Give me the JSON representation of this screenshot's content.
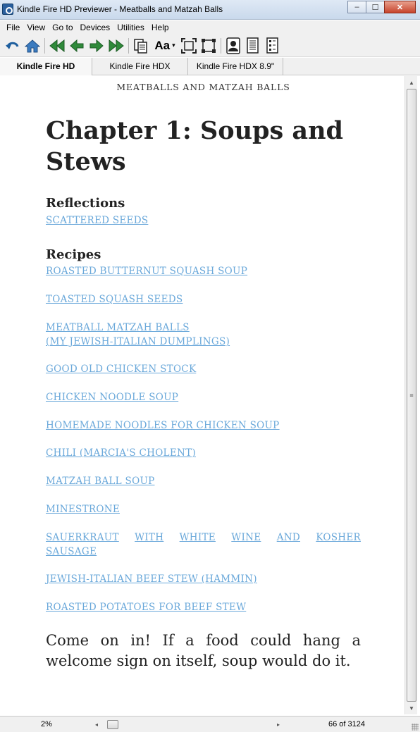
{
  "window": {
    "title": "Kindle Fire HD Previewer - Meatballs and Matzah Balls",
    "minimize_label": "‒",
    "maximize_label": "☐",
    "close_label": "✕"
  },
  "menu": {
    "items": [
      "File",
      "View",
      "Go to",
      "Devices",
      "Utilities",
      "Help"
    ]
  },
  "toolbar": {
    "font_label": "Aa",
    "font_caret": "▾",
    "icons": [
      "undo-icon",
      "home-icon",
      "first-page-icon",
      "previous-page-icon",
      "next-page-icon",
      "last-page-icon",
      "document-icon",
      "font-size-icon",
      "fit-page-icon",
      "full-screen-icon",
      "contact-card-icon",
      "book-page-icon",
      "book-info-icon"
    ]
  },
  "device_tabs": [
    {
      "label": "Kindle Fire HD",
      "active": true
    },
    {
      "label": "Kindle Fire HDX",
      "active": false
    },
    {
      "label": "Kindle Fire HDX 8.9\"",
      "active": false
    }
  ],
  "book": {
    "running_head": "MEATBALLS AND MATZAH BALLS",
    "chapter_title_line1": "Chapter 1: Soups and",
    "chapter_title_line2": "Stews",
    "reflections_heading": "Reflections",
    "reflections_links": [
      "SCATTERED SEEDS"
    ],
    "recipes_heading": "Recipes",
    "recipe_links": [
      "ROASTED BUTTERNUT SQUASH SOUP",
      "TOASTED SQUASH SEEDS",
      "MEATBALL MATZAH BALLS",
      "(MY JEWISH-ITALIAN DUMPLINGS)",
      "GOOD OLD CHICKEN STOCK",
      "CHICKEN NOODLE SOUP",
      "HOMEMADE NOODLES FOR CHICKEN SOUP",
      "CHILI (MARCIA'S CHOLENT)",
      "MATZAH BALL SOUP",
      "MINESTRONE",
      "SAUERKRAUT WITH WHITE WINE AND KOSHER",
      "SAUSAGE",
      "JEWISH-ITALIAN BEEF STEW (HAMMIN)",
      "ROASTED POTATOES FOR BEEF STEW"
    ],
    "intro_text": "Come on in! If a food could hang a welcome sign on itself, soup would do it."
  },
  "status": {
    "percent": "2%",
    "page_position": "66 of 3124",
    "progress_fraction": 0.02
  },
  "colors": {
    "link": "#6aa8da",
    "text": "#222222",
    "chrome": "#f0f0f0"
  }
}
